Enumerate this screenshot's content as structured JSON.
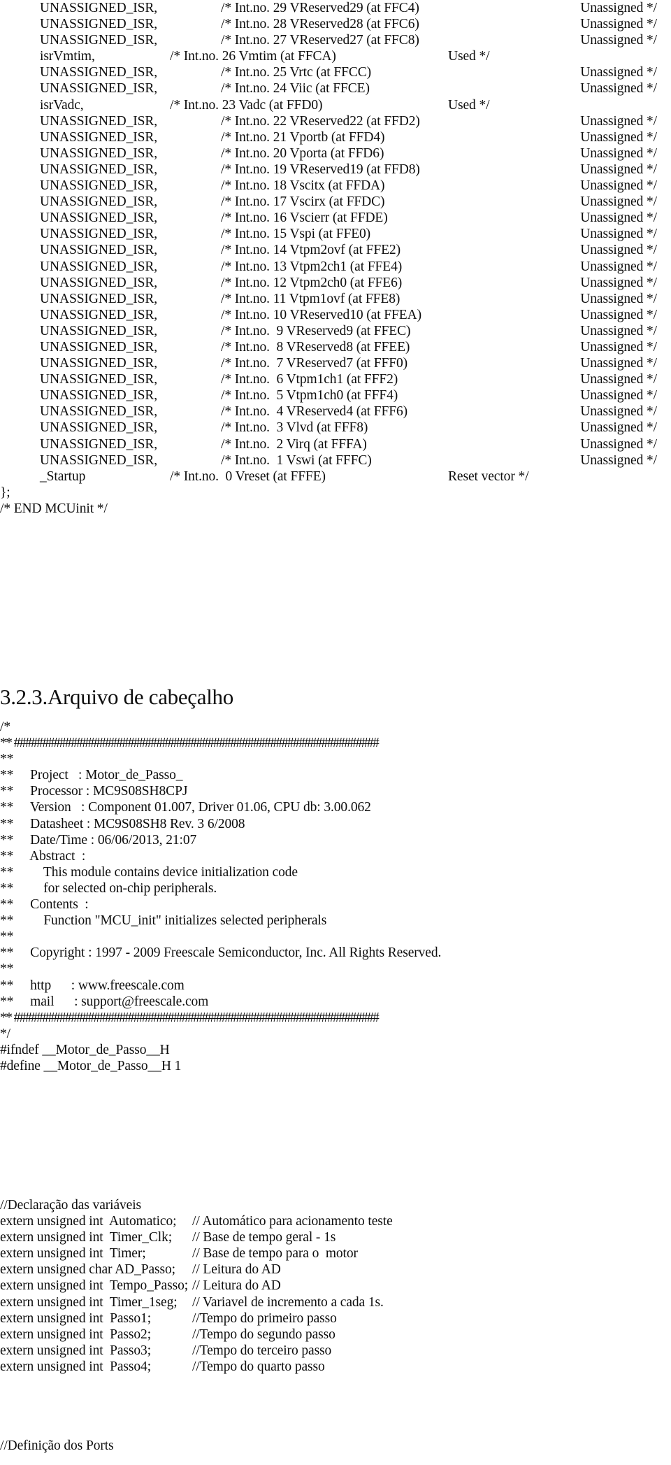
{
  "document": {
    "language": "pt-BR",
    "section_heading": "3.2.3.Arquivo de cabeçalho"
  },
  "isr_table": {
    "rows": [
      {
        "handler": "UNASSIGNED_ISR,",
        "comment": "/* Int.no. 29 VReserved29 (at FFC4)",
        "status": "Unassigned */",
        "used": false
      },
      {
        "handler": "UNASSIGNED_ISR,",
        "comment": "/* Int.no. 28 VReserved28 (at FFC6)",
        "status": "Unassigned */",
        "used": false
      },
      {
        "handler": "UNASSIGNED_ISR,",
        "comment": "/* Int.no. 27 VReserved27 (at FFC8)",
        "status": "Unassigned */",
        "used": false
      },
      {
        "handler": "isrVmtim,",
        "comment": "/* Int.no. 26 Vmtim (at FFCA)",
        "status": "Used */",
        "used": true
      },
      {
        "handler": "UNASSIGNED_ISR,",
        "comment": "/* Int.no. 25 Vrtc (at FFCC)",
        "status": "Unassigned */",
        "used": false
      },
      {
        "handler": "UNASSIGNED_ISR,",
        "comment": "/* Int.no. 24 Viic (at FFCE)",
        "status": "Unassigned */",
        "used": false
      },
      {
        "handler": "isrVadc,",
        "comment": "/* Int.no. 23 Vadc (at FFD0)",
        "status": "Used */",
        "used": true
      },
      {
        "handler": "UNASSIGNED_ISR,",
        "comment": "/* Int.no. 22 VReserved22 (at FFD2)",
        "status": "Unassigned */",
        "used": false
      },
      {
        "handler": "UNASSIGNED_ISR,",
        "comment": "/* Int.no. 21 Vportb (at FFD4)",
        "status": "Unassigned */",
        "used": false
      },
      {
        "handler": "UNASSIGNED_ISR,",
        "comment": "/* Int.no. 20 Vporta (at FFD6)",
        "status": "Unassigned */",
        "used": false
      },
      {
        "handler": "UNASSIGNED_ISR,",
        "comment": "/* Int.no. 19 VReserved19 (at FFD8)",
        "status": "Unassigned */",
        "used": false
      },
      {
        "handler": "UNASSIGNED_ISR,",
        "comment": "/* Int.no. 18 Vscitx (at FFDA)",
        "status": "Unassigned */",
        "used": false
      },
      {
        "handler": "UNASSIGNED_ISR,",
        "comment": "/* Int.no. 17 Vscirx (at FFDC)",
        "status": "Unassigned */",
        "used": false
      },
      {
        "handler": "UNASSIGNED_ISR,",
        "comment": "/* Int.no. 16 Vscierr (at FFDE)",
        "status": "Unassigned */",
        "used": false
      },
      {
        "handler": "UNASSIGNED_ISR,",
        "comment": "/* Int.no. 15 Vspi (at FFE0)",
        "status": "Unassigned */",
        "used": false
      },
      {
        "handler": "UNASSIGNED_ISR,",
        "comment": "/* Int.no. 14 Vtpm2ovf (at FFE2)",
        "status": "Unassigned */",
        "used": false
      },
      {
        "handler": "UNASSIGNED_ISR,",
        "comment": "/* Int.no. 13 Vtpm2ch1 (at FFE4)",
        "status": "Unassigned */",
        "used": false
      },
      {
        "handler": "UNASSIGNED_ISR,",
        "comment": "/* Int.no. 12 Vtpm2ch0 (at FFE6)",
        "status": "Unassigned */",
        "used": false
      },
      {
        "handler": "UNASSIGNED_ISR,",
        "comment": "/* Int.no. 11 Vtpm1ovf (at FFE8)",
        "status": "Unassigned */",
        "used": false
      },
      {
        "handler": "UNASSIGNED_ISR,",
        "comment": "/* Int.no. 10 VReserved10 (at FFEA)",
        "status": "Unassigned */",
        "used": false
      },
      {
        "handler": "UNASSIGNED_ISR,",
        "comment": "/* Int.no.  9 VReserved9 (at FFEC)",
        "status": "Unassigned */",
        "used": false
      },
      {
        "handler": "UNASSIGNED_ISR,",
        "comment": "/* Int.no.  8 VReserved8 (at FFEE)",
        "status": "Unassigned */",
        "used": false
      },
      {
        "handler": "UNASSIGNED_ISR,",
        "comment": "/* Int.no.  7 VReserved7 (at FFF0)",
        "status": "Unassigned */",
        "used": false
      },
      {
        "handler": "UNASSIGNED_ISR,",
        "comment": "/* Int.no.  6 Vtpm1ch1 (at FFF2)",
        "status": "Unassigned */",
        "used": false
      },
      {
        "handler": "UNASSIGNED_ISR,",
        "comment": "/* Int.no.  5 Vtpm1ch0 (at FFF4)",
        "status": "Unassigned */",
        "used": false
      },
      {
        "handler": "UNASSIGNED_ISR,",
        "comment": "/* Int.no.  4 VReserved4 (at FFF6)",
        "status": "Unassigned */",
        "used": false
      },
      {
        "handler": "UNASSIGNED_ISR,",
        "comment": "/* Int.no.  3 Vlvd (at FFF8)",
        "status": "Unassigned */",
        "used": false
      },
      {
        "handler": "UNASSIGNED_ISR,",
        "comment": "/* Int.no.  2 Virq (at FFFA)",
        "status": "Unassigned */",
        "used": false
      },
      {
        "handler": "UNASSIGNED_ISR,",
        "comment": "/* Int.no.  1 Vswi (at FFFC)",
        "status": "Unassigned */",
        "used": false
      },
      {
        "handler": "_Startup",
        "comment": "/* Int.no.  0 Vreset (at FFFE)",
        "status": "Reset vector */",
        "used": true
      }
    ],
    "closing_brace": "};",
    "end_comment": "/* END MCUinit */"
  },
  "header_banner": {
    "open": "/*",
    "rule": "** ################################################################",
    "lines": [
      "**",
      "**     Project   : Motor_de_Passo_",
      "**     Processor : MC9S08SH8CPJ",
      "**     Version   : Component 01.007, Driver 01.06, CPU db: 3.00.062",
      "**     Datasheet : MC9S08SH8 Rev. 3 6/2008",
      "**     Date/Time : 06/06/2013, 21:07",
      "**     Abstract  :",
      "**         This module contains device initialization code",
      "**         for selected on-chip peripherals.",
      "**     Contents  :",
      "**         Function \"MCU_init\" initializes selected peripherals",
      "**",
      "**     Copyright : 1997 - 2009 Freescale Semiconductor, Inc. All Rights Reserved.",
      "**",
      "**     http      : www.freescale.com",
      "**     mail      : support@freescale.com"
    ],
    "close": "*/"
  },
  "include_guard": {
    "ifndef": "#ifndef __Motor_de_Passo__H",
    "define": "#define __Motor_de_Passo__H 1"
  },
  "variables": {
    "section_comment": "//Declaração das variáveis",
    "rows": [
      {
        "decl": "extern unsigned int  Automatico;",
        "comment": "// Automático para acionamento teste"
      },
      {
        "decl": "extern unsigned int  Timer_Clk;",
        "comment": "// Base de tempo geral - 1s"
      },
      {
        "decl": "extern unsigned int  Timer;",
        "comment": "// Base de tempo para o  motor"
      },
      {
        "decl": "extern unsigned char AD_Passo;",
        "comment": "// Leitura do AD"
      },
      {
        "decl": "extern unsigned int  Tempo_Passo;",
        "comment": "// Leitura do AD"
      },
      {
        "decl": "extern unsigned int  Timer_1seg;",
        "comment": "// Variavel de incremento a cada 1s."
      },
      {
        "decl": "extern unsigned int  Passo1;",
        "comment": "//Tempo do primeiro passo"
      },
      {
        "decl": "extern unsigned int  Passo2;",
        "comment": "//Tempo do segundo passo"
      },
      {
        "decl": "extern unsigned int  Passo3;",
        "comment": "//Tempo do terceiro passo"
      },
      {
        "decl": "extern unsigned int  Passo4;",
        "comment": "//Tempo do quarto passo"
      }
    ]
  },
  "ports": {
    "section_comment": "//Definição dos Ports"
  }
}
